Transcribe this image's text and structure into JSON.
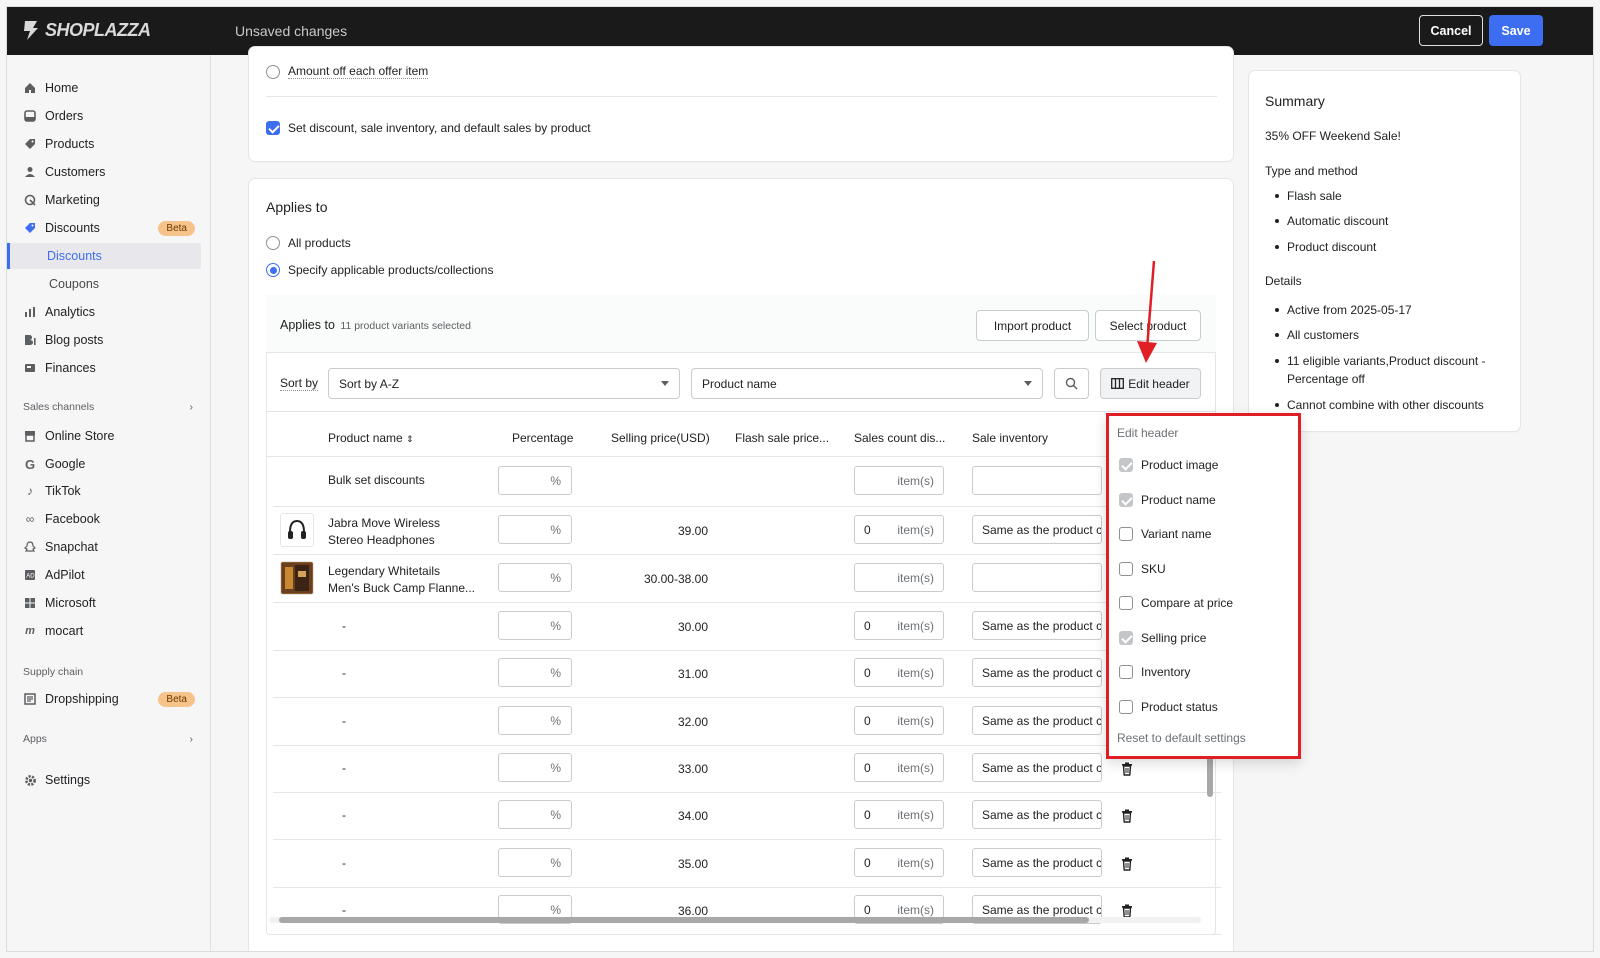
{
  "topbar": {
    "logo": "SHOPLAZZA",
    "status": "Unsaved changes",
    "cancel": "Cancel",
    "save": "Save"
  },
  "sidebar": {
    "items": [
      {
        "label": "Home",
        "icon": "home-icon"
      },
      {
        "label": "Orders",
        "icon": "orders-icon"
      },
      {
        "label": "Products",
        "icon": "tag-icon"
      },
      {
        "label": "Customers",
        "icon": "person-icon"
      },
      {
        "label": "Marketing",
        "icon": "marketing-icon"
      },
      {
        "label": "Discounts",
        "icon": "discount-icon",
        "badge": "Beta"
      },
      {
        "label": "Discounts"
      },
      {
        "label": "Coupons"
      },
      {
        "label": "Analytics",
        "icon": "analytics-icon"
      },
      {
        "label": "Blog posts",
        "icon": "blog-icon"
      },
      {
        "label": "Finances",
        "icon": "finance-icon"
      }
    ],
    "sales_channels_label": "Sales channels",
    "channels": [
      {
        "label": "Online Store"
      },
      {
        "label": "Google"
      },
      {
        "label": "TikTok"
      },
      {
        "label": "Facebook"
      },
      {
        "label": "Snapchat"
      },
      {
        "label": "AdPilot"
      },
      {
        "label": "Microsoft"
      },
      {
        "label": "mocart"
      }
    ],
    "supply_chain_label": "Supply chain",
    "dropshipping": "Dropshipping",
    "dropshipping_badge": "Beta",
    "apps_label": "Apps",
    "settings": "Settings"
  },
  "method_card": {
    "amount_off": "Amount off each offer item",
    "set_by_product": "Set discount, sale inventory, and default sales by product"
  },
  "applies_card": {
    "title": "Applies to",
    "all_products": "All products",
    "specify": "Specify applicable products/collections",
    "applies_label": "Applies to",
    "selected_count": "11 product variants selected",
    "import_btn": "Import product",
    "select_btn": "Select product",
    "sort_label": "Sort by",
    "sort_value": "Sort by A-Z",
    "filter_value": "Product name",
    "edit_header_btn": "Edit header"
  },
  "table": {
    "headers": [
      "Product name",
      "Percentage",
      "Selling price(USD)",
      "Flash sale price...",
      "Sales count dis...",
      "Sale inventory"
    ],
    "bulk_label": "Bulk set discounts",
    "pct_suffix": "%",
    "items_suffix": "item(s)",
    "same_as": "Same as the product cu",
    "same_as_short": "Same as the product c",
    "rows": [
      {
        "name1": "Jabra Move Wireless",
        "name2": "Stereo Headphones",
        "price": "39.00",
        "count": "0",
        "inventory": "Same as the product c"
      },
      {
        "name1": "Legendary Whitetails",
        "name2": "Men's Buck Camp Flanne...",
        "price": "30.00-38.00",
        "count": "",
        "inventory": ""
      },
      {
        "name1": "-",
        "name2": "",
        "price": "30.00",
        "count": "0",
        "inventory": "Same as the product c"
      },
      {
        "name1": "-",
        "name2": "",
        "price": "31.00",
        "count": "0",
        "inventory": "Same as the product c"
      },
      {
        "name1": "-",
        "name2": "",
        "price": "32.00",
        "count": "0",
        "inventory": "Same as the product c"
      },
      {
        "name1": "-",
        "name2": "",
        "price": "33.00",
        "count": "0",
        "inventory": "Same as the product cu"
      },
      {
        "name1": "-",
        "name2": "",
        "price": "34.00",
        "count": "0",
        "inventory": "Same as the product cu"
      },
      {
        "name1": "-",
        "name2": "",
        "price": "35.00",
        "count": "0",
        "inventory": "Same as the product cu"
      },
      {
        "name1": "-",
        "name2": "",
        "price": "36.00",
        "count": "0",
        "inventory": "Same as the product cu"
      }
    ]
  },
  "summary": {
    "title": "Summary",
    "name": "35% OFF Weekend Sale!",
    "type_heading": "Type and method",
    "type_items": [
      "Flash sale",
      "Automatic discount",
      "Product discount"
    ],
    "details_heading": "Details",
    "details_items": [
      "Active from 2025-05-17",
      "All customers",
      "11 eligible variants,Product discount - Percentage off",
      "Cannot combine with other discounts"
    ]
  },
  "edit_header_popover": {
    "title": "Edit header",
    "options": [
      {
        "label": "Product image",
        "checked": true
      },
      {
        "label": "Product name",
        "checked": true
      },
      {
        "label": "Variant name",
        "checked": false
      },
      {
        "label": "SKU",
        "checked": false
      },
      {
        "label": "Compare at price",
        "checked": false
      },
      {
        "label": "Selling price",
        "checked": true
      },
      {
        "label": "Inventory",
        "checked": false
      },
      {
        "label": "Product status",
        "checked": false
      }
    ],
    "reset": "Reset to default settings"
  },
  "colors": {
    "accent": "#3d6df0",
    "highlight": "#e01e26",
    "topbar": "#1a1a1a"
  }
}
